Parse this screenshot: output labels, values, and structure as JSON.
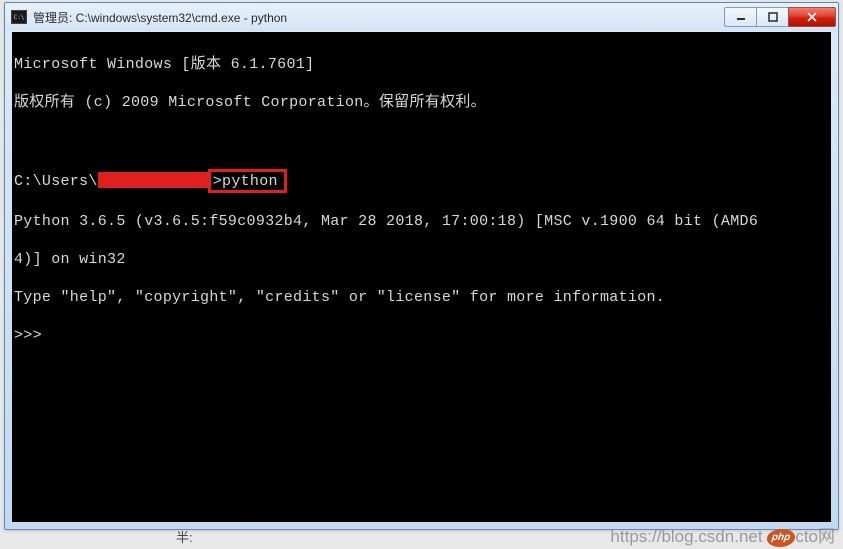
{
  "window": {
    "title": "管理员: C:\\windows\\system32\\cmd.exe - python"
  },
  "controls": {
    "minimize": "minimize",
    "maximize": "maximize",
    "close": "close"
  },
  "terminal": {
    "line1": "Microsoft Windows [版本 6.1.7601]",
    "line2": "版权所有 (c) 2009 Microsoft Corporation。保留所有权利。",
    "prompt_prefix": "C:\\Users\\",
    "prompt_suffix": ">python",
    "py_line1a": "Python 3.6.5 (v3.6.5:f59c0932b4, Mar 28 2018, 17:00:18) [MSC v.1900 64 bit (AMD6",
    "py_line1b": "4)] on win32",
    "py_help": "Type \"help\", \"copyright\", \"credits\" or \"license\" for more information.",
    "repl": ">>> "
  },
  "caption": "半:",
  "watermark": {
    "text": "https://blog.csdn.net",
    "logo": "php",
    "suffix": "cto网"
  }
}
